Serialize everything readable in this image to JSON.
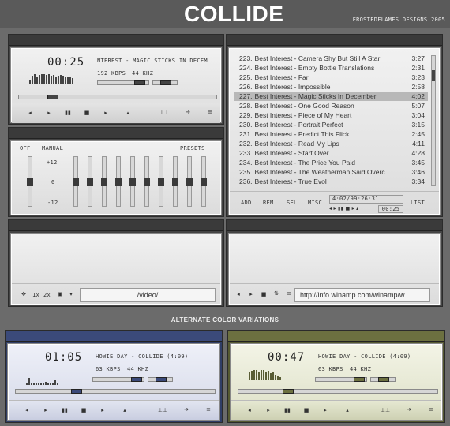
{
  "header": {
    "title": "COLLIDE",
    "credit": "FROSTEDFLAMES DESIGNS 2005"
  },
  "main_player": {
    "time": "00:25",
    "title": "NTEREST - MAGIC STICKS IN DECEM",
    "kbps": "192 KBPS",
    "khz": "44 KHZ",
    "progress": 0.17,
    "controls": [
      "◂",
      "▸",
      "▮▮",
      "■",
      "▸▸",
      "▴",
      "⊥⊥",
      "➔",
      "≡"
    ]
  },
  "equalizer": {
    "off": "OFF",
    "manual": "MANUAL",
    "presets": "PRESETS",
    "db_top": "+12",
    "db_mid": "0",
    "db_bot": "-12",
    "bands": 10
  },
  "playlist": {
    "items": [
      {
        "n": "223.",
        "title": "Best Interest - Camera Shy But Still A Star",
        "dur": "3:27"
      },
      {
        "n": "224.",
        "title": "Best Interest - Empty Bottle Translations",
        "dur": "2:31"
      },
      {
        "n": "225.",
        "title": "Best Interest - Far",
        "dur": "3:23"
      },
      {
        "n": "226.",
        "title": "Best Interest - Impossible",
        "dur": "2:58"
      },
      {
        "n": "227.",
        "title": "Best Interest - Magic Sticks In December",
        "dur": "4:02"
      },
      {
        "n": "228.",
        "title": "Best Interest - One Good Reason",
        "dur": "5:07"
      },
      {
        "n": "229.",
        "title": "Best Interest - Piece of My Heart",
        "dur": "3:04"
      },
      {
        "n": "230.",
        "title": "Best Interest - Portrait Perfect",
        "dur": "3:15"
      },
      {
        "n": "231.",
        "title": "Best Interest - Predict This Flick",
        "dur": "2:45"
      },
      {
        "n": "232.",
        "title": "Best Interest - Read My Lips",
        "dur": "4:11"
      },
      {
        "n": "233.",
        "title": "Best Interest - Start Over",
        "dur": "4:28"
      },
      {
        "n": "234.",
        "title": "Best Interest - The Price You Paid",
        "dur": "3:45"
      },
      {
        "n": "235.",
        "title": "Best Interest - The Weatherman Said Overc...",
        "dur": "3:46"
      },
      {
        "n": "236.",
        "title": "Best Interest - True Evol",
        "dur": "3:34"
      }
    ],
    "selected_index": 4,
    "buttons": {
      "add": "ADD",
      "rem": "REM",
      "sel": "SEL",
      "misc": "MISC",
      "list": "LIST"
    },
    "total_time": "4:02/99:26:31",
    "mini_time": "00:25"
  },
  "video": {
    "path": "/video/",
    "x1": "1x",
    "x2": "2x"
  },
  "browser": {
    "url": "http://info.winamp.com/winamp/w"
  },
  "alt_label": "ALTERNATE COLOR VARIATIONS",
  "alt_blue": {
    "time": "01:05",
    "title": "HOWIE DAY - COLLIDE (4:09)",
    "kbps": "63 KBPS",
    "khz": "44 KHZ",
    "accent": "#3b4a7a"
  },
  "alt_green": {
    "time": "00:47",
    "title": "HOWIE DAY - COLLIDE (4:09)",
    "kbps": "63 KBPS",
    "khz": "44 KHZ",
    "accent": "#6c7040"
  }
}
